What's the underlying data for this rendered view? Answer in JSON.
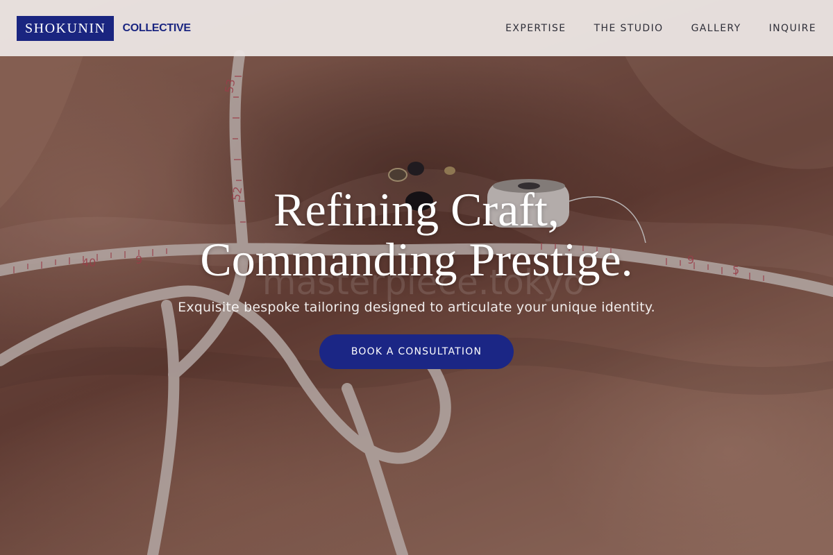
{
  "brand": {
    "name": "SHOKUNIN",
    "subtitle": "COLLECTIVE",
    "color": "#1a2580"
  },
  "nav": {
    "items": [
      {
        "label": "EXPERTISE"
      },
      {
        "label": "THE STUDIO"
      },
      {
        "label": "GALLERY"
      },
      {
        "label": "INQUIRE"
      }
    ]
  },
  "hero": {
    "title_line1": "Refining Craft,",
    "title_line2": "Commanding Prestige.",
    "subtitle": "Exquisite bespoke tailoring designed to articulate your unique identity.",
    "cta_label": "BOOK A CONSULTATION",
    "cta_color": "#1b2685",
    "watermark": "masterpiece.tokyo",
    "background_image": "silk fabric with measuring tapes, buttons and thread spool"
  }
}
